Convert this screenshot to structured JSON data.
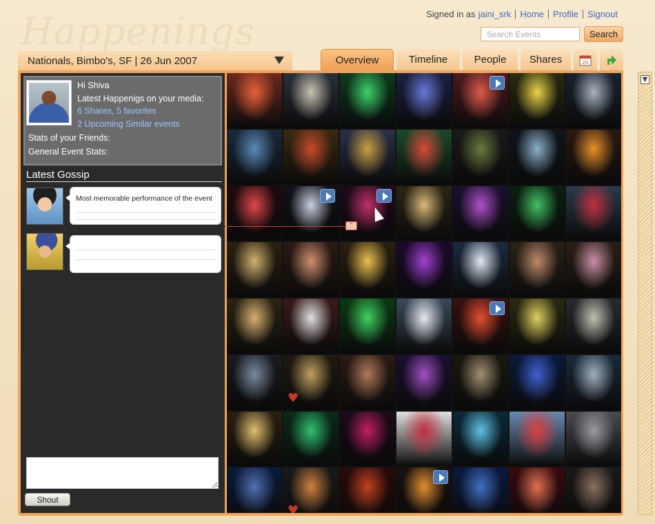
{
  "app": {
    "logo": "Happenings"
  },
  "topnav": {
    "signed_in_prefix": "Signed in as",
    "username": "jaini_srk",
    "links": [
      "Home",
      "Profile",
      "Signout"
    ]
  },
  "search": {
    "placeholder": "Search Events",
    "button_label": "Search"
  },
  "event": {
    "selected": "Nationals, Bimbo's, SF | 26 Jun 2007"
  },
  "tabs": [
    {
      "label": "Overview",
      "active": true
    },
    {
      "label": "Timeline"
    },
    {
      "label": "People"
    },
    {
      "label": "Shares"
    }
  ],
  "tab_icons": {
    "calendar": "calendar-icon",
    "share": "arrow-icon",
    "calendar_day": "20"
  },
  "profile": {
    "greeting": "Hi Shiva",
    "latest_label": "Latest Happenigs on your media:",
    "shares_link": "6 Shares,",
    "favorites_link": "5 favorites",
    "upcoming_link": "2 Upcoming Similar events",
    "friends_stats": "Stats of your Friends:",
    "general_stats": "General Event Stats:"
  },
  "gossip": {
    "title": "Latest Gossip",
    "items": [
      {
        "text": "Most memorable performance of the event"
      },
      {
        "text": ""
      }
    ]
  },
  "shout": {
    "button_label": "Shout"
  },
  "colors": {
    "accent": "#f0a45a",
    "link": "#3e6cc0",
    "panel": "#2a2a2a",
    "profile_box": "#6b6b6b"
  },
  "photos": [
    {
      "c": "#6b2a1e",
      "h": "#e8603a",
      "play": false
    },
    {
      "c": "#2a2f3a",
      "h": "#c9c4b0",
      "play": false
    },
    {
      "c": "#0d3a1e",
      "h": "#3fd06a",
      "play": false
    },
    {
      "c": "#1b2040",
      "h": "#6a78d8",
      "play": false
    },
    {
      "c": "#4a1a1e",
      "h": "#e05a4a",
      "play": true
    },
    {
      "c": "#2a2a10",
      "h": "#e8d24a",
      "play": false
    },
    {
      "c": "#1a2230",
      "h": "#a8b4c0",
      "play": false
    },
    {
      "c": "#1a2a3a",
      "h": "#5a8ab8",
      "play": false
    },
    {
      "c": "#3a2a10",
      "h": "#c84a2a",
      "play": false
    },
    {
      "c": "#2a3048",
      "h": "#c8a040",
      "play": false
    },
    {
      "c": "#1a4a2a",
      "h": "#d84a3a",
      "play": false
    },
    {
      "c": "#1a1a1a",
      "h": "#6a7a3a",
      "play": false
    },
    {
      "c": "#10151a",
      "h": "#8ab0c8",
      "play": false
    },
    {
      "c": "#2a1a10",
      "h": "#e8902a",
      "play": false
    },
    {
      "c": "#200a10",
      "h": "#e04848",
      "play": false
    },
    {
      "c": "#101018",
      "h": "#c8d0e0",
      "play": true
    },
    {
      "c": "#200a1a",
      "h": "#c0306a",
      "play": true
    },
    {
      "c": "#2a2414",
      "h": "#d8b878",
      "play": false
    },
    {
      "c": "#1a1030",
      "h": "#b050c8",
      "play": false
    },
    {
      "c": "#0a2010",
      "h": "#40c060",
      "play": false
    },
    {
      "c": "#2a3a4a",
      "h": "#c03040",
      "play": false
    },
    {
      "c": "#2a2210",
      "h": "#d0b070",
      "play": false
    },
    {
      "c": "#2a1a14",
      "h": "#d09070",
      "play": false
    },
    {
      "c": "#2a2010",
      "h": "#e8c050",
      "play": false
    },
    {
      "c": "#1a0a2a",
      "h": "#a040d0",
      "play": false
    },
    {
      "c": "#1a2a40",
      "h": "#e0e8f0",
      "play": false
    },
    {
      "c": "#2a2218",
      "h": "#c08a6a",
      "play": false
    },
    {
      "c": "#2a2014",
      "h": "#c890a8",
      "play": false
    },
    {
      "c": "#2a2410",
      "h": "#d8b070",
      "play": false
    },
    {
      "c": "#3a1a1a",
      "h": "#e0e0e0",
      "play": false
    },
    {
      "c": "#0a3a14",
      "h": "#40d060",
      "play": false
    },
    {
      "c": "#3a4a5a",
      "h": "#e8e8f0",
      "play": false
    },
    {
      "c": "#3a1010",
      "h": "#e05030",
      "play": true
    },
    {
      "c": "#2a2a10",
      "h": "#e0d060",
      "play": false
    },
    {
      "c": "#2a2a30",
      "h": "#c0c0b0",
      "play": false
    },
    {
      "c": "#1a1a20",
      "h": "#7a8aa0",
      "play": false
    },
    {
      "c": "#201a10",
      "h": "#c0a060",
      "play": false
    },
    {
      "c": "#2a1a14",
      "h": "#b07a5a",
      "play": false
    },
    {
      "c": "#1a1030",
      "h": "#a050c0",
      "play": false
    },
    {
      "c": "#1a1810",
      "h": "#a09070",
      "play": false
    },
    {
      "c": "#0a1a3a",
      "h": "#4060d0",
      "play": false
    },
    {
      "c": "#1a2a3a",
      "h": "#a0b0c0",
      "play": false
    },
    {
      "c": "#2a2010",
      "h": "#e0c070",
      "play": false
    },
    {
      "c": "#0a2a1a",
      "h": "#30c070",
      "play": false
    },
    {
      "c": "#1a0a1a",
      "h": "#c02060",
      "play": false
    },
    {
      "c": "#e0e0e0",
      "h": "#c03040",
      "play": false
    },
    {
      "c": "#0a2a3a",
      "h": "#60c0e0",
      "play": false
    },
    {
      "c": "#6a8ab0",
      "h": "#d84040",
      "play": false
    },
    {
      "c": "#4a4a50",
      "h": "#9a9aa0",
      "play": false
    },
    {
      "c": "#0a1a3a",
      "h": "#5070b0",
      "play": false
    },
    {
      "c": "#1a1a1a",
      "h": "#d08040",
      "play": false
    },
    {
      "c": "#2a0a0a",
      "h": "#c04020",
      "play": false
    },
    {
      "c": "#1a1010",
      "h": "#e09030",
      "play": true
    },
    {
      "c": "#0a1a40",
      "h": "#4070c0",
      "play": false
    },
    {
      "c": "#3a0a10",
      "h": "#e07050",
      "play": false
    },
    {
      "c": "#1a1a1a",
      "h": "#8a7060",
      "play": false
    }
  ]
}
